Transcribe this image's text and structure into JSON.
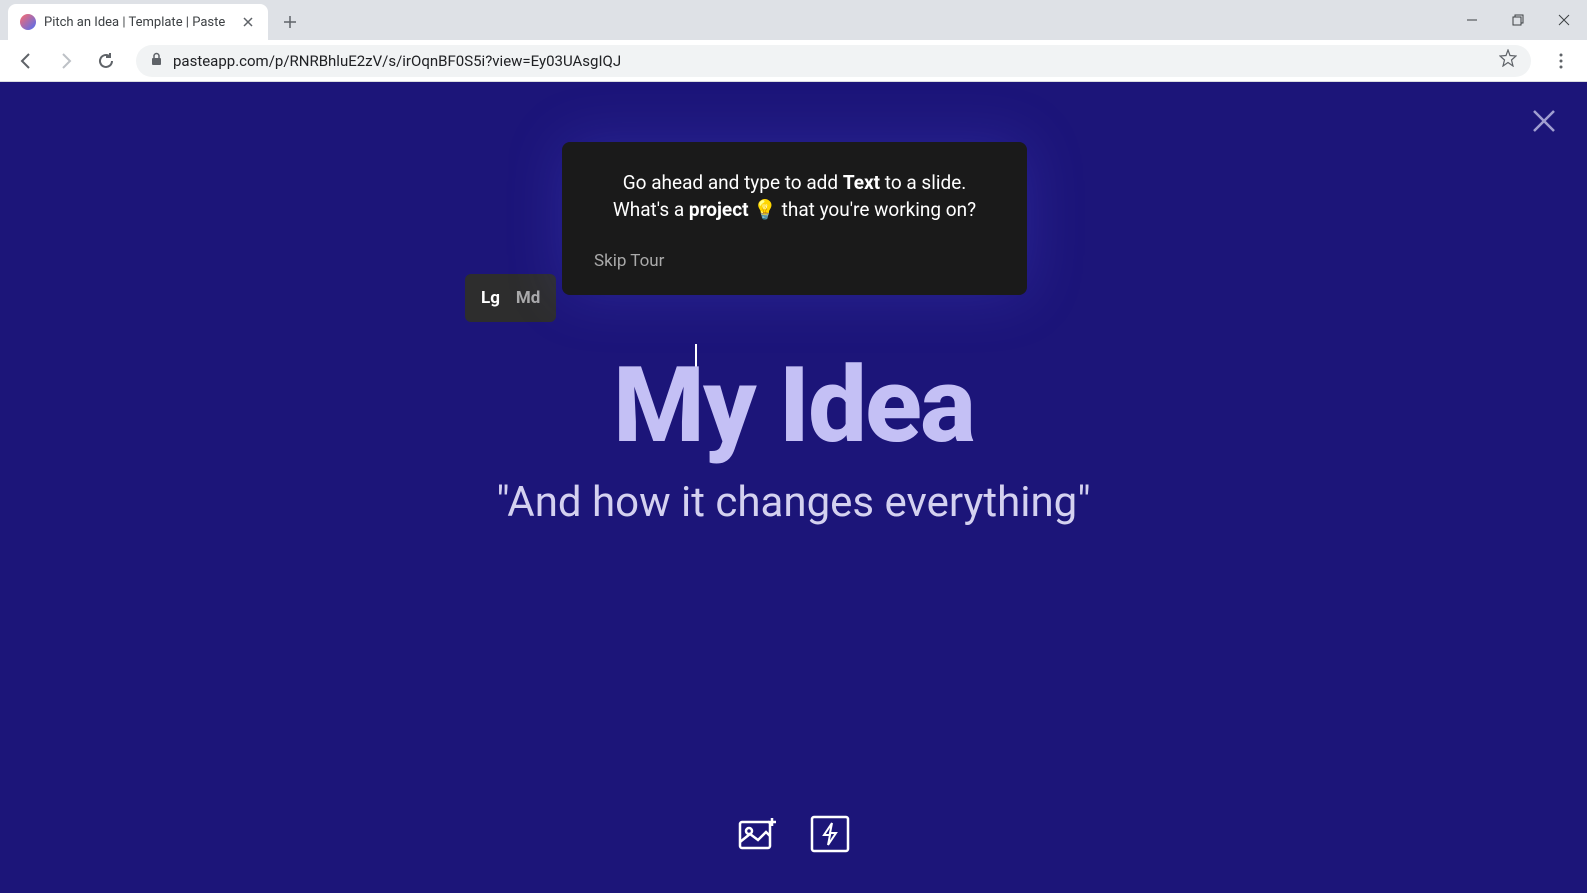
{
  "browser": {
    "tab_title": "Pitch an Idea | Template | Paste",
    "url": "pasteapp.com/p/RNRBhluE2zV/s/irOqnBF0S5i?view=Ey03UAsgIQJ"
  },
  "tooltip": {
    "line1_prefix": "Go ahead and type to add ",
    "line1_bold": "Text",
    "line1_suffix": " to a slide.",
    "line2_prefix": "What's a ",
    "line2_bold": "project",
    "line2_emoji": "💡",
    "line2_suffix": " that you're working on?",
    "skip_label": "Skip Tour"
  },
  "toolbar": {
    "size_lg": "Lg",
    "size_md": "Md"
  },
  "slide": {
    "title": "My Idea",
    "subtitle": "\"And how it changes everything\""
  }
}
